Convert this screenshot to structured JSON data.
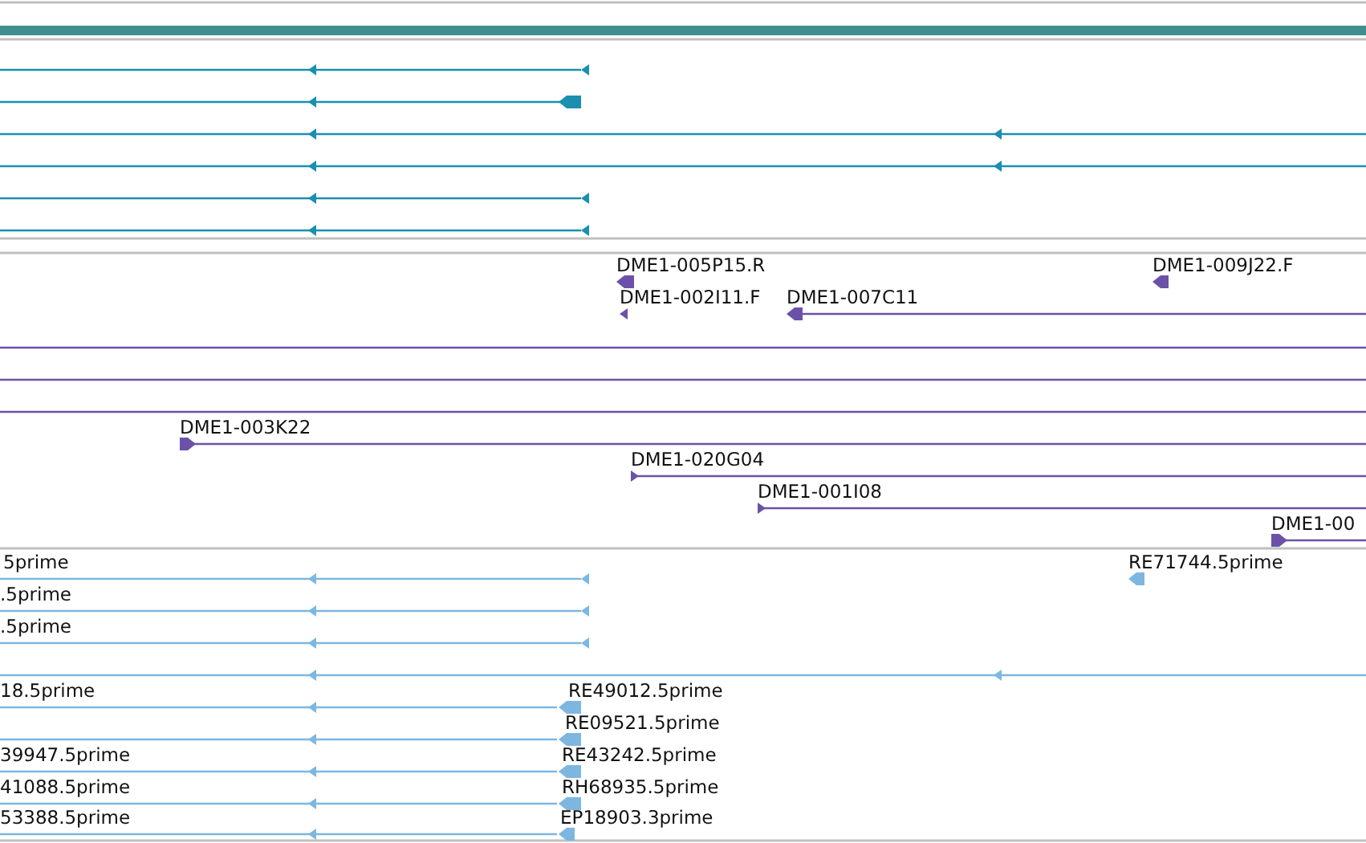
{
  "tracks": [
    {
      "color": "#1a8fb0",
      "features": [
        {
          "reverse": true
        },
        {
          "reverse": true
        },
        {
          "reverse": true
        },
        {
          "reverse": true
        },
        {
          "reverse": true
        },
        {
          "reverse": true
        }
      ]
    },
    {
      "color": "#6b52a8",
      "features": [
        {
          "label": "DME1-005P15.R",
          "reverse": true
        },
        {
          "label": "DME1-009J22.F",
          "reverse": true
        },
        {
          "label": "DME1-002I11.F",
          "reverse": true
        },
        {
          "label": "DME1-007C11",
          "reverse": true
        },
        {
          "label": "DME1-003K22",
          "reverse": false
        },
        {
          "label": "DME1-020G04",
          "reverse": false
        },
        {
          "label": "DME1-001I08",
          "reverse": false
        },
        {
          "label": "DME1-00",
          "reverse": false
        }
      ]
    },
    {
      "color": "#7db7e0",
      "features": [
        {
          "label": "5prime",
          "reverse": true
        },
        {
          "label": "RE71744.5prime",
          "reverse": true
        },
        {
          "label": ".5prime",
          "reverse": true
        },
        {
          "label": ".5prime",
          "reverse": true
        },
        {
          "reverse": true
        },
        {
          "label": "18.5prime",
          "reverse": true
        },
        {
          "label": "RE49012.5prime",
          "reverse": true
        },
        {
          "reverse": true
        },
        {
          "label": "RE09521.5prime",
          "reverse": true
        },
        {
          "label": "39947.5prime",
          "reverse": true
        },
        {
          "label": "RE43242.5prime",
          "reverse": true
        },
        {
          "label": "41088.5prime",
          "reverse": true
        },
        {
          "label": "RH68935.5prime",
          "reverse": true
        },
        {
          "label": "53388.5prime",
          "reverse": true
        },
        {
          "label": "EP18903.3prime",
          "reverse": true
        }
      ]
    }
  ]
}
